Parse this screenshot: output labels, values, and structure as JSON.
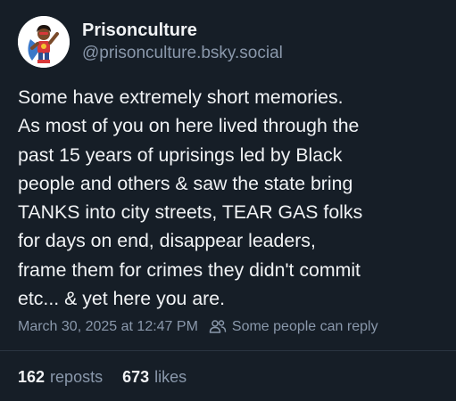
{
  "author": {
    "display_name": "Prisonculture",
    "handle": "@prisonculture.bsky.social",
    "avatar_icon": "superhero-avatar-icon"
  },
  "post": {
    "text": "Some have extremely short memories.\nAs most of you on here lived through the\npast 15 years of uprisings led by Black\npeople and others & saw the state bring\nTANKS into city streets, TEAR GAS folks\nfor days on end, disappear leaders,\nframe them for crimes they didn't commit\netc... & yet here you are."
  },
  "meta": {
    "timestamp": "March 30, 2025 at 12:47 PM",
    "reply_setting": "Some people can reply",
    "reply_icon": "people-icon"
  },
  "stats": {
    "reposts_count": "162",
    "reposts_label": "reposts",
    "likes_count": "673",
    "likes_label": "likes"
  },
  "colors": {
    "background": "#161e27",
    "text": "#f1f3f5",
    "muted": "#8a98ab",
    "divider": "#2a3441"
  }
}
